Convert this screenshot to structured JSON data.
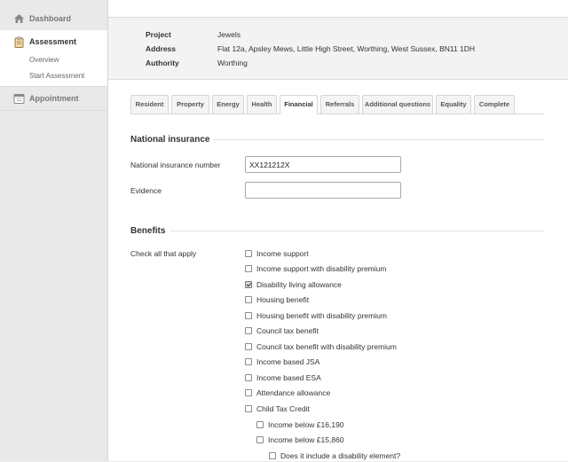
{
  "sidebar": {
    "dashboard": "Dashboard",
    "assessment": "Assessment",
    "sub_items": [
      "Overview",
      "Start Assessment"
    ],
    "appointment": "Appointment"
  },
  "summary": {
    "project_label": "Project",
    "project_value": "Jewels",
    "address_label": "Address",
    "address_value": "Flat 12a, Apsley Mews, Little High Street, Worthing, West Sussex, BN11 1DH",
    "authority_label": "Authority",
    "authority_value": "Worthing"
  },
  "tabs": [
    "Resident",
    "Property",
    "Energy",
    "Health",
    "Financial",
    "Referrals",
    "Additional questions",
    "Equality",
    "Complete"
  ],
  "active_tab": "Financial",
  "national_insurance": {
    "title": "National insurance",
    "number_label": "National insurance number",
    "number_value": "XX121212X",
    "evidence_label": "Evidence",
    "evidence_value": ""
  },
  "benefits": {
    "title": "Benefits",
    "check_label": "Check all that apply",
    "options": [
      {
        "label": "Income support",
        "checked": false
      },
      {
        "label": "Income support with disability premium",
        "checked": false
      },
      {
        "label": "Disability living allowance",
        "checked": true
      },
      {
        "label": "Housing benefit",
        "checked": false
      },
      {
        "label": "Housing benefit with disability premium",
        "checked": false
      },
      {
        "label": "Council tax benefit",
        "checked": false
      },
      {
        "label": "Council tax benefit with disability premium",
        "checked": false
      },
      {
        "label": "Income based JSA",
        "checked": false
      },
      {
        "label": "Income based ESA",
        "checked": false
      },
      {
        "label": "Attendance allowance",
        "checked": false
      },
      {
        "label": "Child Tax Credit",
        "checked": false
      },
      {
        "label": "Income below £16,190",
        "checked": false
      },
      {
        "label": "Income below £15,860",
        "checked": false
      },
      {
        "label": "Does it include a disability element?",
        "checked": false
      }
    ]
  },
  "icons": [
    "home-icon",
    "clipboard-icon",
    "calendar-icon"
  ]
}
